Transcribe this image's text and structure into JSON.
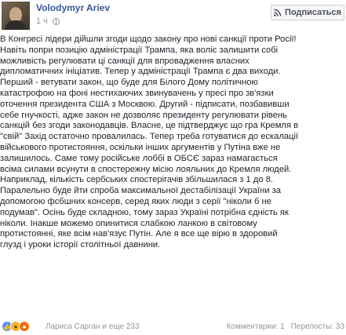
{
  "header": {
    "author": "Volodymyr Ariev",
    "time": "1 ч",
    "follow_label": "Подписаться"
  },
  "post": {
    "lines": [
      "В Конгресі лідери дійшли згоди щодо закону про нові санкції проти Росії!",
      "Навіть попри позицію адміністрації Трампа, яка воліє залишити собі",
      "можливість регулювати ці санкції для впровадження власних",
      "дипломатичних ініціатив. Тепер у адміністрації Трампа є два виходи.",
      "Перший - ветувати закон, що буде для Білого Дому політичною",
      "катастрофою на фоні нестихаючих звинувачень у пресі про зв'язки",
      "оточення президента США з Москвою. Другий - підписати, позбавивши",
      "себе гнучкості, адже закон не дозволяє президенту регулювати рівень",
      "санкцій без згоди законодавців. Власне, це підтверджує що гра Кремля в",
      "\"свій\" Захід остаточно провалилась. Тепер треба готуватися до ескалації",
      "військового протистояння, оскільки інших аргументів у Путіна вже не",
      "залишилось. Саме тому російське лоббі в ОБСЄ зараз намагається",
      "всіма силами всунути в спостережну місію лояльних до Кремля людей.",
      "Наприклад, кількість сербських спостерігачів збільшилася з 1 до 8.",
      "Паралельно буде йти спроба максимальної дестабілізації України за",
      "допомогою фсбшних консерв, серед яких люди з серії \"ніколи б не",
      "подумав\". Осінь буде складною, тому зараз Україні потрібна єдність як",
      "ніколи. Інакше можемо опинитися слабкою ланкою в світовому",
      "протистоянні, яке всім нав'язує Путін. Але я все ще вірю в здоровий",
      "глузд і уроки історії столітньої давнини."
    ]
  },
  "footer": {
    "reactors": "Лариса Сарган и еще 233",
    "comments": "Комментарии: 1",
    "shares": "Перепосты: 33",
    "reaction_icons": [
      "like-icon",
      "wow-icon",
      "angry-icon"
    ]
  },
  "colors": {
    "author": "#365899",
    "meta": "#90949c",
    "text": "#1d2129"
  }
}
